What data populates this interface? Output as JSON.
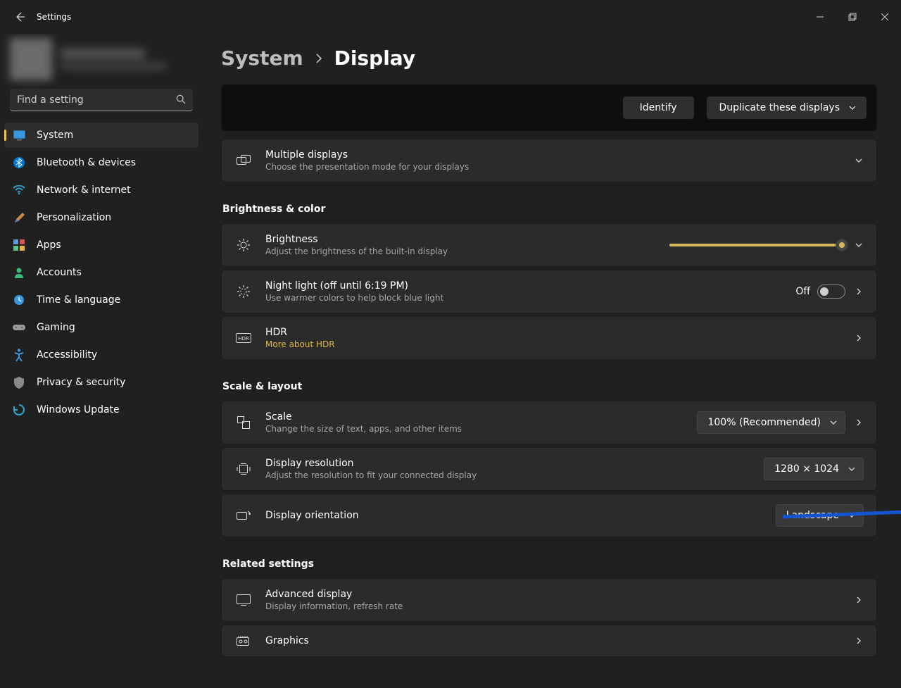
{
  "window": {
    "title": "Settings"
  },
  "search": {
    "placeholder": "Find a setting"
  },
  "sidebar": {
    "items": [
      {
        "label": "System"
      },
      {
        "label": "Bluetooth & devices"
      },
      {
        "label": "Network & internet"
      },
      {
        "label": "Personalization"
      },
      {
        "label": "Apps"
      },
      {
        "label": "Accounts"
      },
      {
        "label": "Time & language"
      },
      {
        "label": "Gaming"
      },
      {
        "label": "Accessibility"
      },
      {
        "label": "Privacy & security"
      },
      {
        "label": "Windows Update"
      }
    ]
  },
  "breadcrumb": {
    "parent": "System",
    "current": "Display"
  },
  "header": {
    "identify": "Identify",
    "duplicate": "Duplicate these displays"
  },
  "multiple": {
    "title": "Multiple displays",
    "sub": "Choose the presentation mode for your displays"
  },
  "sections": {
    "brightness_color": "Brightness & color",
    "scale_layout": "Scale & layout",
    "related": "Related settings"
  },
  "brightness": {
    "title": "Brightness",
    "sub": "Adjust the brightness of the built-in display"
  },
  "nightlight": {
    "title": "Night light (off until 6:19 PM)",
    "sub": "Use warmer colors to help block blue light",
    "state": "Off"
  },
  "hdr": {
    "title": "HDR",
    "sub": "More about HDR"
  },
  "scale": {
    "title": "Scale",
    "sub": "Change the size of text, apps, and other items",
    "value": "100% (Recommended)"
  },
  "resolution": {
    "title": "Display resolution",
    "sub": "Adjust the resolution to fit your connected display",
    "value": "1280 × 1024"
  },
  "orientation": {
    "title": "Display orientation",
    "value": "Landscape"
  },
  "advanced": {
    "title": "Advanced display",
    "sub": "Display information, refresh rate"
  },
  "graphics": {
    "title": "Graphics"
  }
}
